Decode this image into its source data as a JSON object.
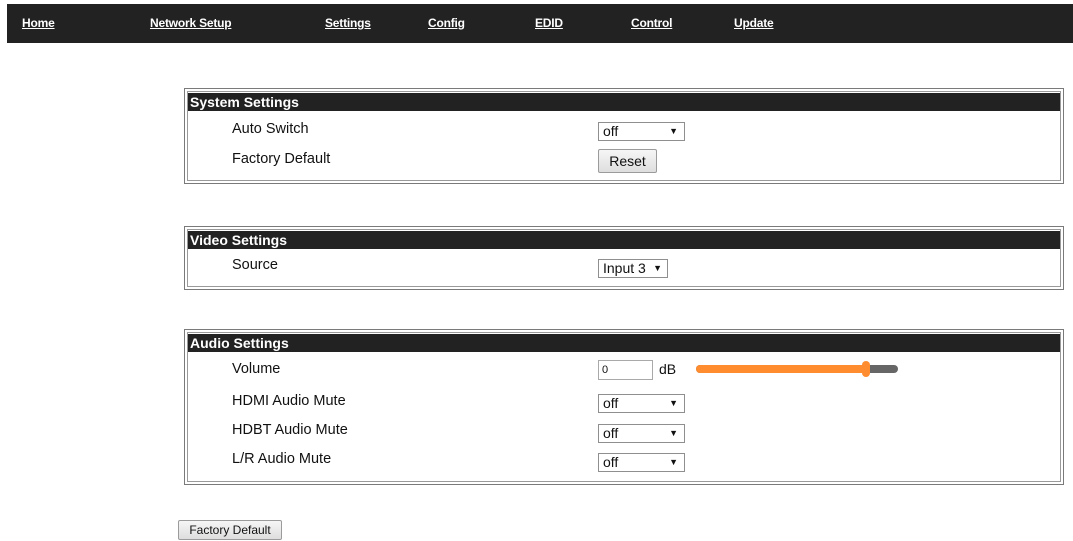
{
  "nav": {
    "items": [
      "Home",
      "Network Setup",
      "Settings",
      "Config",
      "EDID",
      "Control",
      "Update"
    ]
  },
  "system_settings": {
    "title": "System Settings",
    "auto_switch": {
      "label": "Auto Switch",
      "value": "off"
    },
    "factory_default": {
      "label": "Factory Default",
      "button": "Reset"
    }
  },
  "video_settings": {
    "title": "Video Settings",
    "source": {
      "label": "Source",
      "value": "Input 3"
    }
  },
  "audio_settings": {
    "title": "Audio Settings",
    "volume": {
      "label": "Volume",
      "value": "0",
      "unit": "dB",
      "slider_level": 0.84
    },
    "hdmi_mute": {
      "label": "HDMI Audio Mute",
      "value": "off"
    },
    "hdbt_mute": {
      "label": "HDBT Audio Mute",
      "value": "off"
    },
    "lr_mute": {
      "label": "L/R Audio Mute",
      "value": "off"
    }
  },
  "footer": {
    "factory_default_button": "Factory Default"
  },
  "colors": {
    "nav_bg": "#222222",
    "slider_fill": "#ff8c2e",
    "slider_track": "#666666"
  },
  "icons": {
    "dropdown": "dropdown-arrow-icon"
  }
}
